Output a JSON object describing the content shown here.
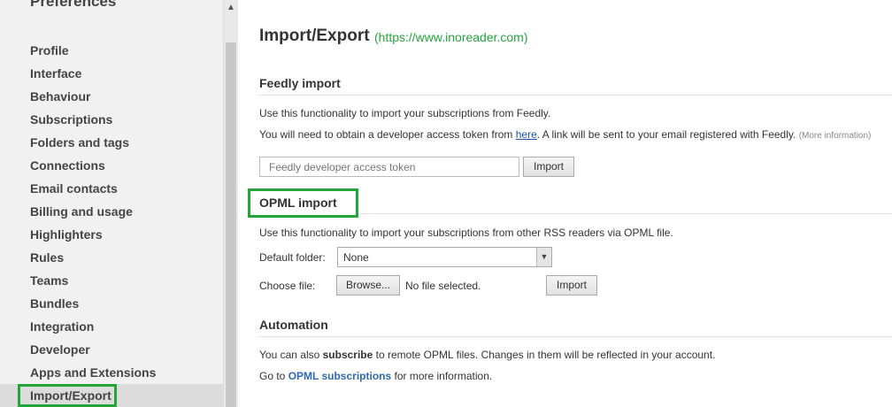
{
  "sidebar": {
    "title": "Preferences",
    "items": [
      {
        "label": "Profile"
      },
      {
        "label": "Interface"
      },
      {
        "label": "Behaviour"
      },
      {
        "label": "Subscriptions"
      },
      {
        "label": "Folders and tags"
      },
      {
        "label": "Connections"
      },
      {
        "label": "Email contacts"
      },
      {
        "label": "Billing and usage"
      },
      {
        "label": "Highlighters"
      },
      {
        "label": "Rules"
      },
      {
        "label": "Teams"
      },
      {
        "label": "Bundles"
      },
      {
        "label": "Integration"
      },
      {
        "label": "Developer"
      },
      {
        "label": "Apps and Extensions"
      },
      {
        "label": "Import/Export"
      }
    ],
    "active": "Import/Export"
  },
  "main": {
    "title": "Import/Export",
    "url": "(https://www.inoreader.com)",
    "feedly": {
      "heading": "Feedly import",
      "line1": "Use this functionality to import your subscriptions from Feedly.",
      "line2_pre": "You will need to obtain a developer access token from ",
      "line2_link": "here",
      "line2_post": ". A link will be sent to your email registered with Feedly.",
      "more_info": "(More information)",
      "token_placeholder": "Feedly developer access token",
      "import_label": "Import"
    },
    "opml": {
      "heading": "OPML import",
      "line1": "Use this functionality to import your subscriptions from other RSS readers via OPML file.",
      "default_folder_label": "Default folder:",
      "default_folder_value": "None",
      "choose_file_label": "Choose file:",
      "browse_label": "Browse...",
      "no_file": "No file selected.",
      "import_label": "Import"
    },
    "automation": {
      "heading": "Automation",
      "line1_pre": "You can also ",
      "line1_bold": "subscribe",
      "line1_post": " to remote OPML files. Changes in them will be reflected in your account.",
      "line2_pre": "Go to ",
      "line2_link": "OPML subscriptions",
      "line2_post": " for more information."
    }
  },
  "colors": {
    "highlight_green": "#23a53b",
    "link_blue": "#1a56b0",
    "sidebar_bg": "#f1f1f1"
  }
}
